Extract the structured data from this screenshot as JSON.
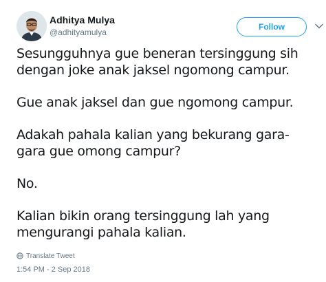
{
  "user": {
    "name": "Adhitya Mulya",
    "handle": "@adhityamulya"
  },
  "follow_label": "Follow",
  "tweet": {
    "paragraphs": [
      [
        "Sesungguhnya gue beneran tersinggung sih",
        "dengan joke anak jaksel ngomong campur."
      ],
      [
        "Gue anak jaksel dan gue ngomong campur."
      ],
      [
        "Adakah pahala kalian yang bekurang gara-",
        "gara gue omong campur?"
      ],
      [
        "No."
      ],
      [
        "Kalian bikin orang tersinggung lah yang",
        "mengurangi pahala kalian."
      ]
    ]
  },
  "translate_label": "Translate Tweet",
  "timestamp": "1:54 PM - 2 Sep 2018",
  "colors": {
    "accent": "#1da1f2",
    "text": "#14171a",
    "muted": "#657786"
  },
  "icons": {
    "translate": "globe-icon",
    "more": "chevron-down-icon"
  }
}
